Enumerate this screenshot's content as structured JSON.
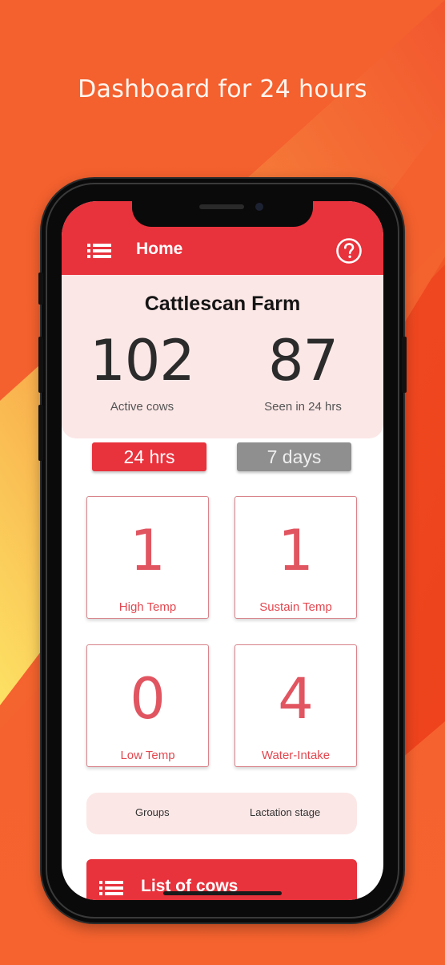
{
  "promo": {
    "title": "Dashboard for 24 hours"
  },
  "appbar": {
    "title": "Home",
    "menu_icon": "hamburger-list-icon",
    "help_icon": "question-circle-icon"
  },
  "farm": {
    "name": "Cattlescan Farm",
    "active_cows": "102",
    "active_cows_label": "Active cows",
    "seen": "87",
    "seen_label": "Seen in 24 hrs"
  },
  "period": {
    "day_label": "24 hrs",
    "week_label": "7 days",
    "selected": "24 hrs"
  },
  "alerts": [
    {
      "value": "1",
      "label": "High Temp"
    },
    {
      "value": "1",
      "label": "Sustain Temp"
    },
    {
      "value": "0",
      "label": "Low Temp"
    },
    {
      "value": "4",
      "label": "Water-Intake"
    }
  ],
  "filters": {
    "groups": "Groups",
    "lactation": "Lactation stage"
  },
  "list": {
    "title": "List of cows",
    "icon": "hamburger-list-icon"
  },
  "colors": {
    "background": "#f4602f",
    "accent_red": "#e8323c",
    "card_pink": "#fbe7e6",
    "inactive_gray": "#8f8f8f",
    "yellow_glow": "#fde96a"
  }
}
